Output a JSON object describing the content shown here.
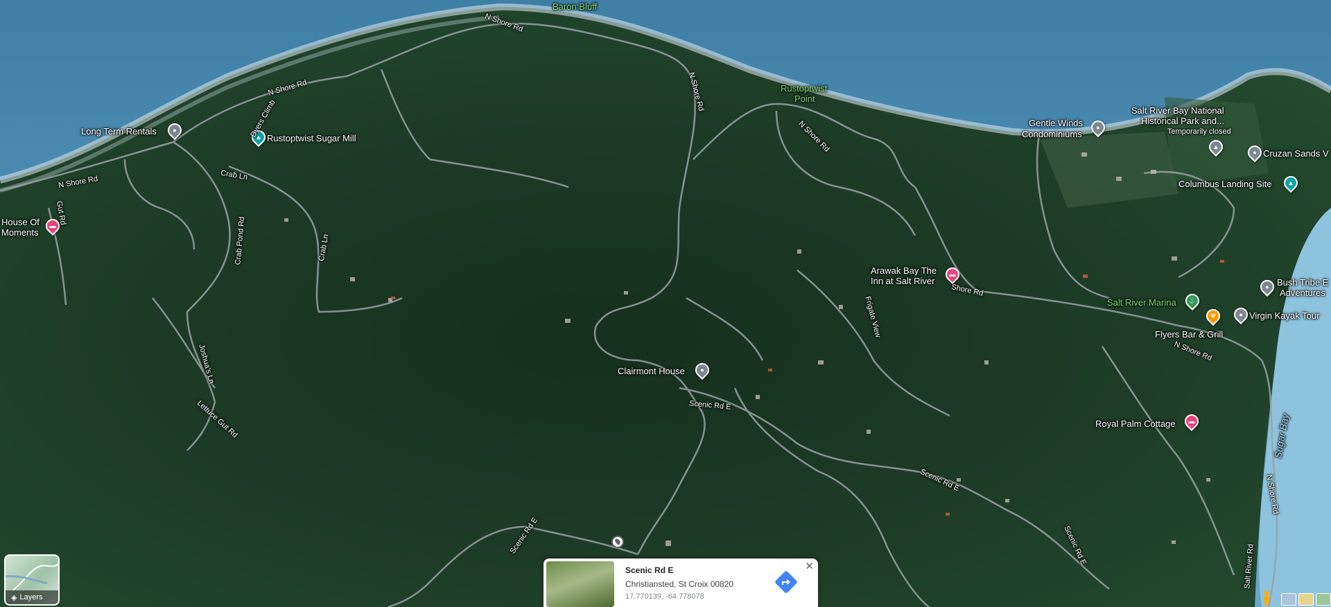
{
  "map": {
    "type": "satellite",
    "places": [
      {
        "name": "Baron Bluff",
        "style": "green"
      },
      {
        "name": "Long Term Rentals",
        "icon": "gray-pin-icon"
      },
      {
        "name": "Rustoptwist Sugar Mill",
        "icon": "teal-landmark-pin-icon"
      },
      {
        "name": "House Of",
        "icon": "pink-hotel-pin-icon"
      },
      {
        "name": "Moments"
      },
      {
        "name": "Rustoptwist",
        "style": "green"
      },
      {
        "name": "Point",
        "style": "green"
      },
      {
        "name": "Gentle Winds",
        "icon": "gray-pin-icon"
      },
      {
        "name": "Condominiums"
      },
      {
        "name": "Salt River Bay National"
      },
      {
        "name": "Historical Park and..."
      },
      {
        "name": "Temporarily closed"
      },
      {
        "name": "Cruzan Sands V",
        "icon": "gray-pin-icon"
      },
      {
        "name": "Columbus Landing Site",
        "icon": "teal-landmark-pin-icon"
      },
      {
        "name": "Arawak Bay The",
        "icon": "pink-hotel-pin-icon"
      },
      {
        "name": "Inn at Salt River"
      },
      {
        "name": "Salt River Marina",
        "icon": "green-marina-pin-icon",
        "style": "green"
      },
      {
        "name": "Flyers Bar & Grill",
        "icon": "orange-restaurant-pin-icon"
      },
      {
        "name": "Virgin Kayak Tour",
        "icon": "gray-pin-icon"
      },
      {
        "name": "Bush Tribe E",
        "icon": "gray-pin-icon"
      },
      {
        "name": "Adventures"
      },
      {
        "name": "Clairmont House",
        "icon": "gray-pin-icon"
      },
      {
        "name": "Royal Palm Cottage",
        "icon": "pink-hotel-pin-icon"
      },
      {
        "name": "Sugar Bay",
        "style": "water"
      }
    ],
    "roads": [
      "N Shore Rd",
      "N Shore Rd",
      "N Shore Rd",
      "N Shore Rd",
      "N Shore Rd",
      "Shore Rd",
      "N Shore Rd",
      "Dyers Climb",
      "Crab Ln",
      "Crab Pond Rd",
      "Crab Ln",
      "Joshua's Ln",
      "Lettuce Gut Rd",
      "Gut Rd",
      "Frigate View",
      "Scenic Rd E",
      "Scenic Rd E",
      "Scenic Rd E",
      "Scenic Rd E",
      "N Shore Rd",
      "Salt River Rd"
    ]
  },
  "layers_button": {
    "label": "Layers"
  },
  "info_card": {
    "title": "Scenic Rd E",
    "address": "Christiansted, St Croix 00820",
    "coordinates": "17.770139, -64.778078"
  },
  "colors": {
    "sea": "#4f8fb3",
    "land": "#1d3c26",
    "pink_pin": "#e8437a",
    "teal_pin": "#12a3a8",
    "directions": "#4285f4"
  }
}
